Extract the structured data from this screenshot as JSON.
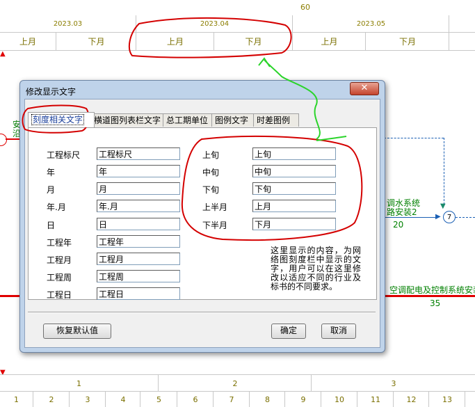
{
  "timeline": {
    "top_number": "60",
    "months": [
      "2023.03",
      "2023.04",
      "2023.05"
    ],
    "halves": [
      "上月",
      "下月",
      "上月",
      "下月",
      "上月",
      "下月"
    ],
    "bottom_groups": [
      "1",
      "2",
      "3"
    ],
    "bottom_days": [
      "1",
      "2",
      "3",
      "4",
      "5",
      "6",
      "7",
      "8",
      "9",
      "10",
      "11",
      "12",
      "13"
    ]
  },
  "network": {
    "left_label_a": "安",
    "left_label_b": "沿",
    "task1_line1": "调水系统",
    "task1_line2": "路安装2",
    "task1_duration": "20",
    "node_number": "7",
    "task2_label": "空调配电及控制系统安装",
    "task2_duration": "35"
  },
  "dialog": {
    "title": "修改显示文字",
    "close_symbol": "✕",
    "tabs": [
      "刻度相关文字",
      "横道图列表栏文字",
      "总工期单位",
      "图例文字",
      "时差图例"
    ],
    "left_fields": [
      {
        "label": "工程标尺",
        "value": "工程标尺"
      },
      {
        "label": "年",
        "value": "年"
      },
      {
        "label": "月",
        "value": "月"
      },
      {
        "label": "年.月",
        "value": "年.月"
      },
      {
        "label": "日",
        "value": "日"
      },
      {
        "label": "工程年",
        "value": "工程年"
      },
      {
        "label": "工程月",
        "value": "工程月"
      },
      {
        "label": "工程周",
        "value": "工程周"
      },
      {
        "label": "工程日",
        "value": "工程日"
      }
    ],
    "right_fields": [
      {
        "label": "上旬",
        "value": "上旬"
      },
      {
        "label": "中旬",
        "value": "中旬"
      },
      {
        "label": "下旬",
        "value": "下旬"
      },
      {
        "label": "上半月",
        "value": "上月"
      },
      {
        "label": "下半月",
        "value": "下月"
      }
    ],
    "note": "这里显示的内容，为网络图刻度栏中显示的文字，用户可以在这里修改以适应不同的行业及标书的不同要求。",
    "buttons": {
      "restore": "恢复默认值",
      "ok": "确定",
      "cancel": "取消"
    }
  },
  "colors": {
    "annotation_red": "#d40000",
    "annotation_green": "#2bd42b",
    "timeline_text": "#8b7d00",
    "task_green": "#008000",
    "critical_red": "#e00000"
  }
}
